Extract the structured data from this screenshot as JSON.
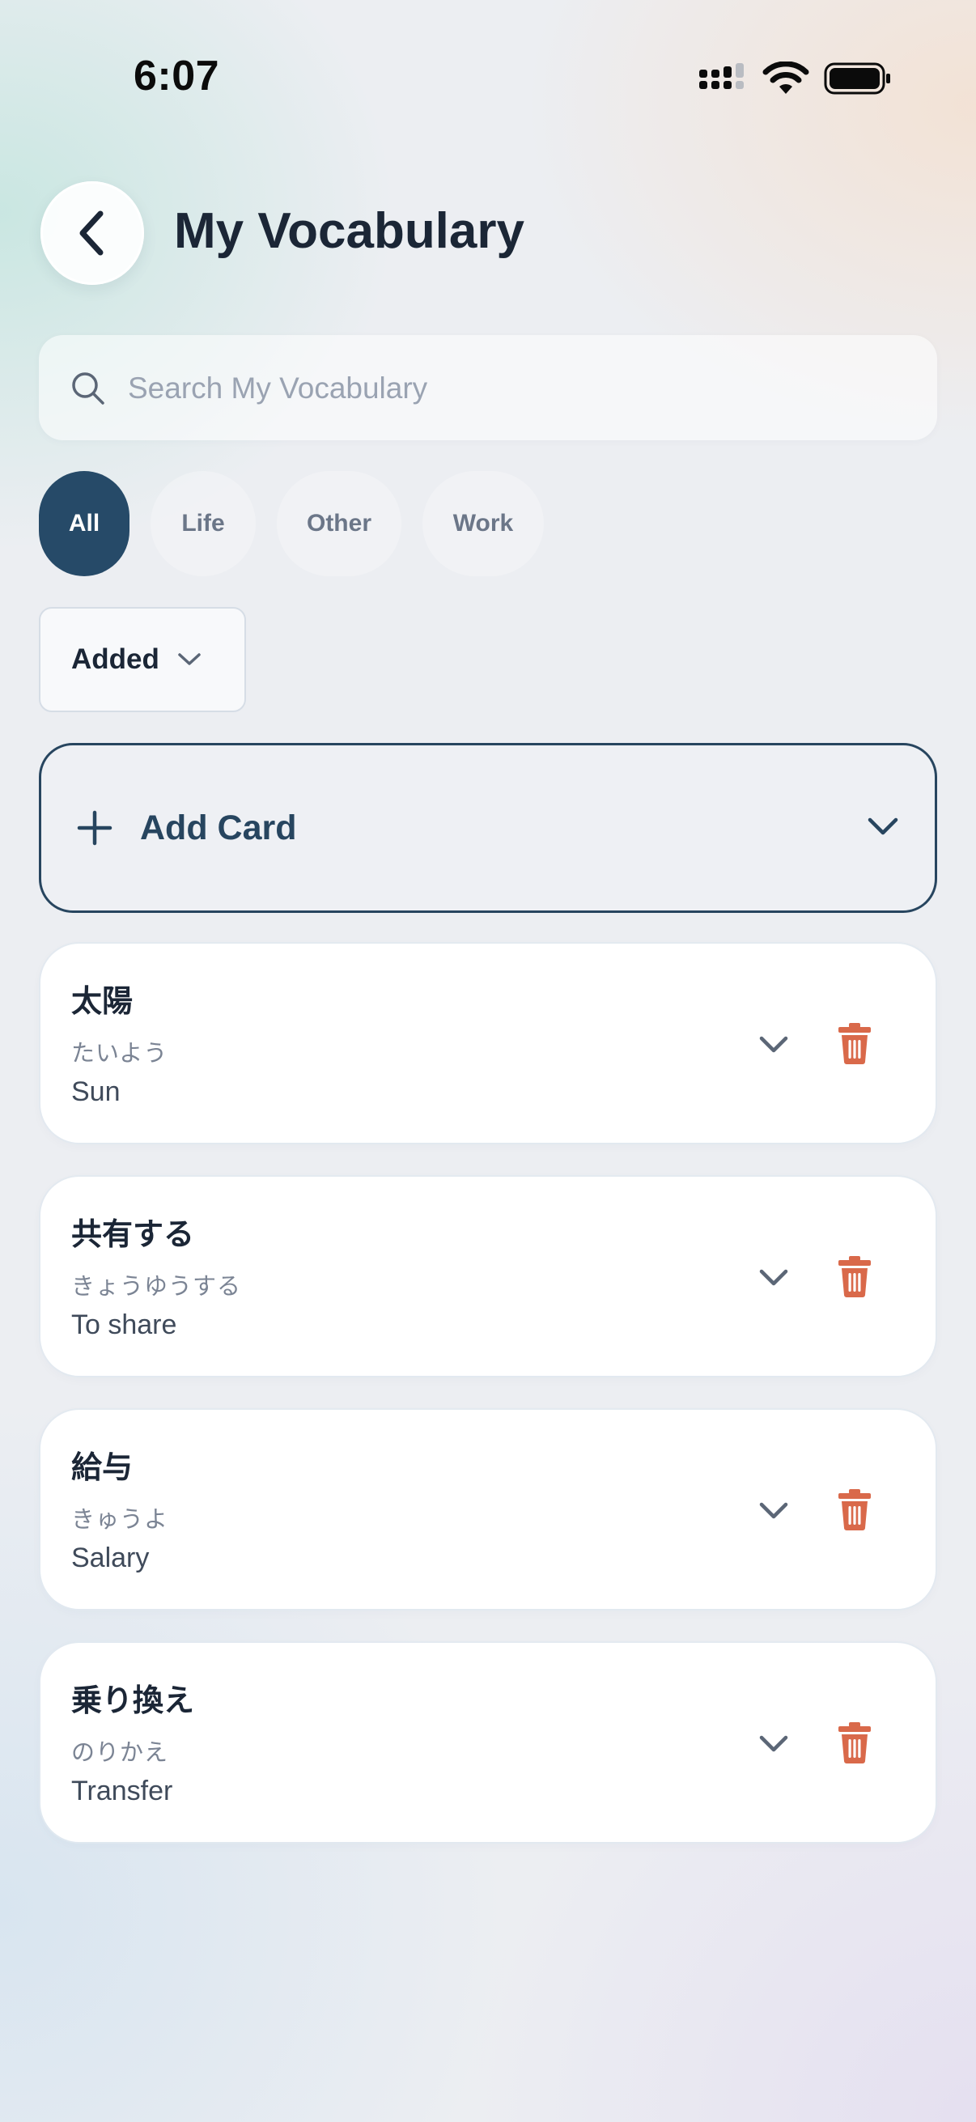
{
  "status_bar": {
    "time": "6:07"
  },
  "header": {
    "title": "My Vocabulary"
  },
  "search": {
    "placeholder": "Search My Vocabulary",
    "value": ""
  },
  "filters": {
    "chips": [
      {
        "label": "All",
        "active": true
      },
      {
        "label": "Life",
        "active": false
      },
      {
        "label": "Other",
        "active": false
      },
      {
        "label": "Work",
        "active": false
      }
    ]
  },
  "sort": {
    "selected": "Added"
  },
  "add_card": {
    "label": "Add Card"
  },
  "cards": [
    {
      "term": "太陽",
      "reading": "たいよう",
      "meaning": "Sun"
    },
    {
      "term": "共有する",
      "reading": "きょうゆうする",
      "meaning": "To share"
    },
    {
      "term": "給与",
      "reading": "きゅうよ",
      "meaning": "Salary"
    },
    {
      "term": "乗り換え",
      "reading": "のりかえ",
      "meaning": "Transfer"
    }
  ],
  "colors": {
    "accent": "#264a68",
    "delete": "#d9694a",
    "title": "#1b2636"
  },
  "icons": [
    "back-chevron-icon",
    "search-icon",
    "chevron-down-icon",
    "plus-icon",
    "trash-icon",
    "cellular-signal-icon",
    "wifi-icon",
    "battery-icon"
  ]
}
